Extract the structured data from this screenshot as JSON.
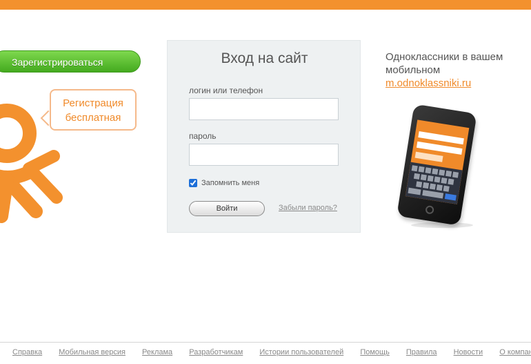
{
  "colors": {
    "brand_orange": "#f3912e",
    "register_green": "#44aa1f",
    "link_orange": "#f08a2a"
  },
  "register": {
    "label": "Зарегистрироваться"
  },
  "promo": {
    "line1": "Регистрация",
    "line2": "бесплатная"
  },
  "login": {
    "title": "Вход на сайт",
    "login_label": "логин или телефон",
    "login_value": "",
    "password_label": "пароль",
    "password_value": "",
    "remember_label": "Запомнить меня",
    "remember_checked": true,
    "submit_label": "Войти",
    "forgot_label": "Забыли пароль?"
  },
  "mobile": {
    "text": "Одноклассники в вашем мобильном",
    "link": "m.odnoklassniki.ru"
  },
  "footer": {
    "links": [
      "Справка",
      "Мобильная версия",
      "Реклама",
      "Разработчикам",
      "Истории пользователей",
      "Помощь",
      "Правила",
      "Новости",
      "О компании"
    ]
  }
}
